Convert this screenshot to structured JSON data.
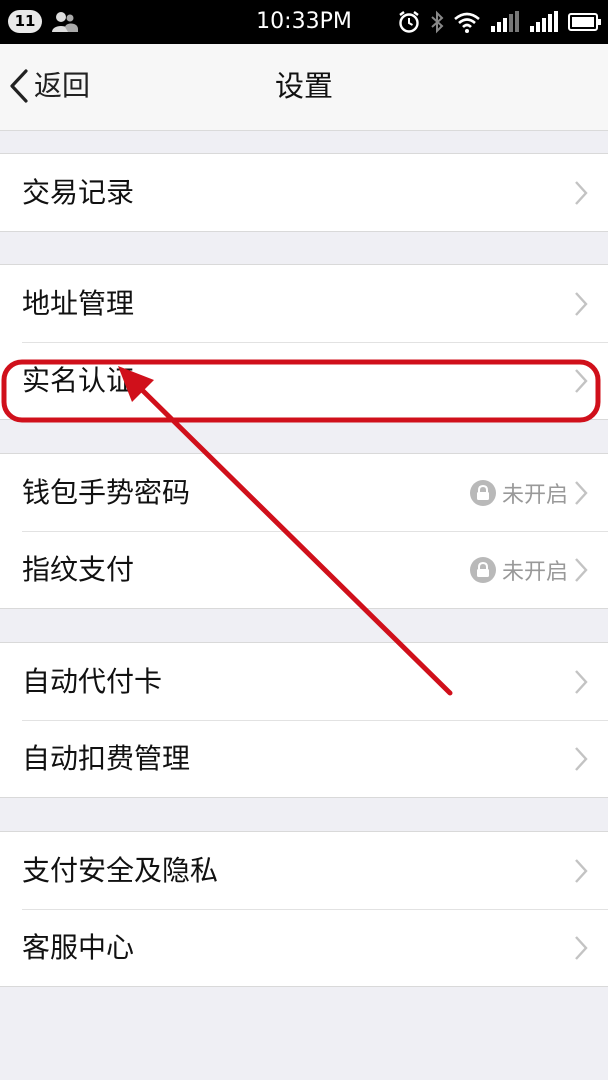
{
  "status_bar": {
    "notification_count": "11",
    "time": "10:33PM"
  },
  "nav": {
    "back_label": "返回",
    "title": "设置"
  },
  "groups": [
    {
      "items": [
        {
          "label": "交易记录"
        }
      ]
    },
    {
      "items": [
        {
          "label": "地址管理"
        },
        {
          "label": "实名认证"
        }
      ]
    },
    {
      "items": [
        {
          "label": "钱包手势密码",
          "status": "未开启"
        },
        {
          "label": "指纹支付",
          "status": "未开启"
        }
      ]
    },
    {
      "items": [
        {
          "label": "自动代付卡"
        },
        {
          "label": "自动扣费管理"
        }
      ]
    },
    {
      "items": [
        {
          "label": "支付安全及隐私"
        },
        {
          "label": "客服中心"
        }
      ]
    }
  ],
  "annotation": {
    "highlighted_item": "实名认证",
    "color": "#d0101b"
  }
}
